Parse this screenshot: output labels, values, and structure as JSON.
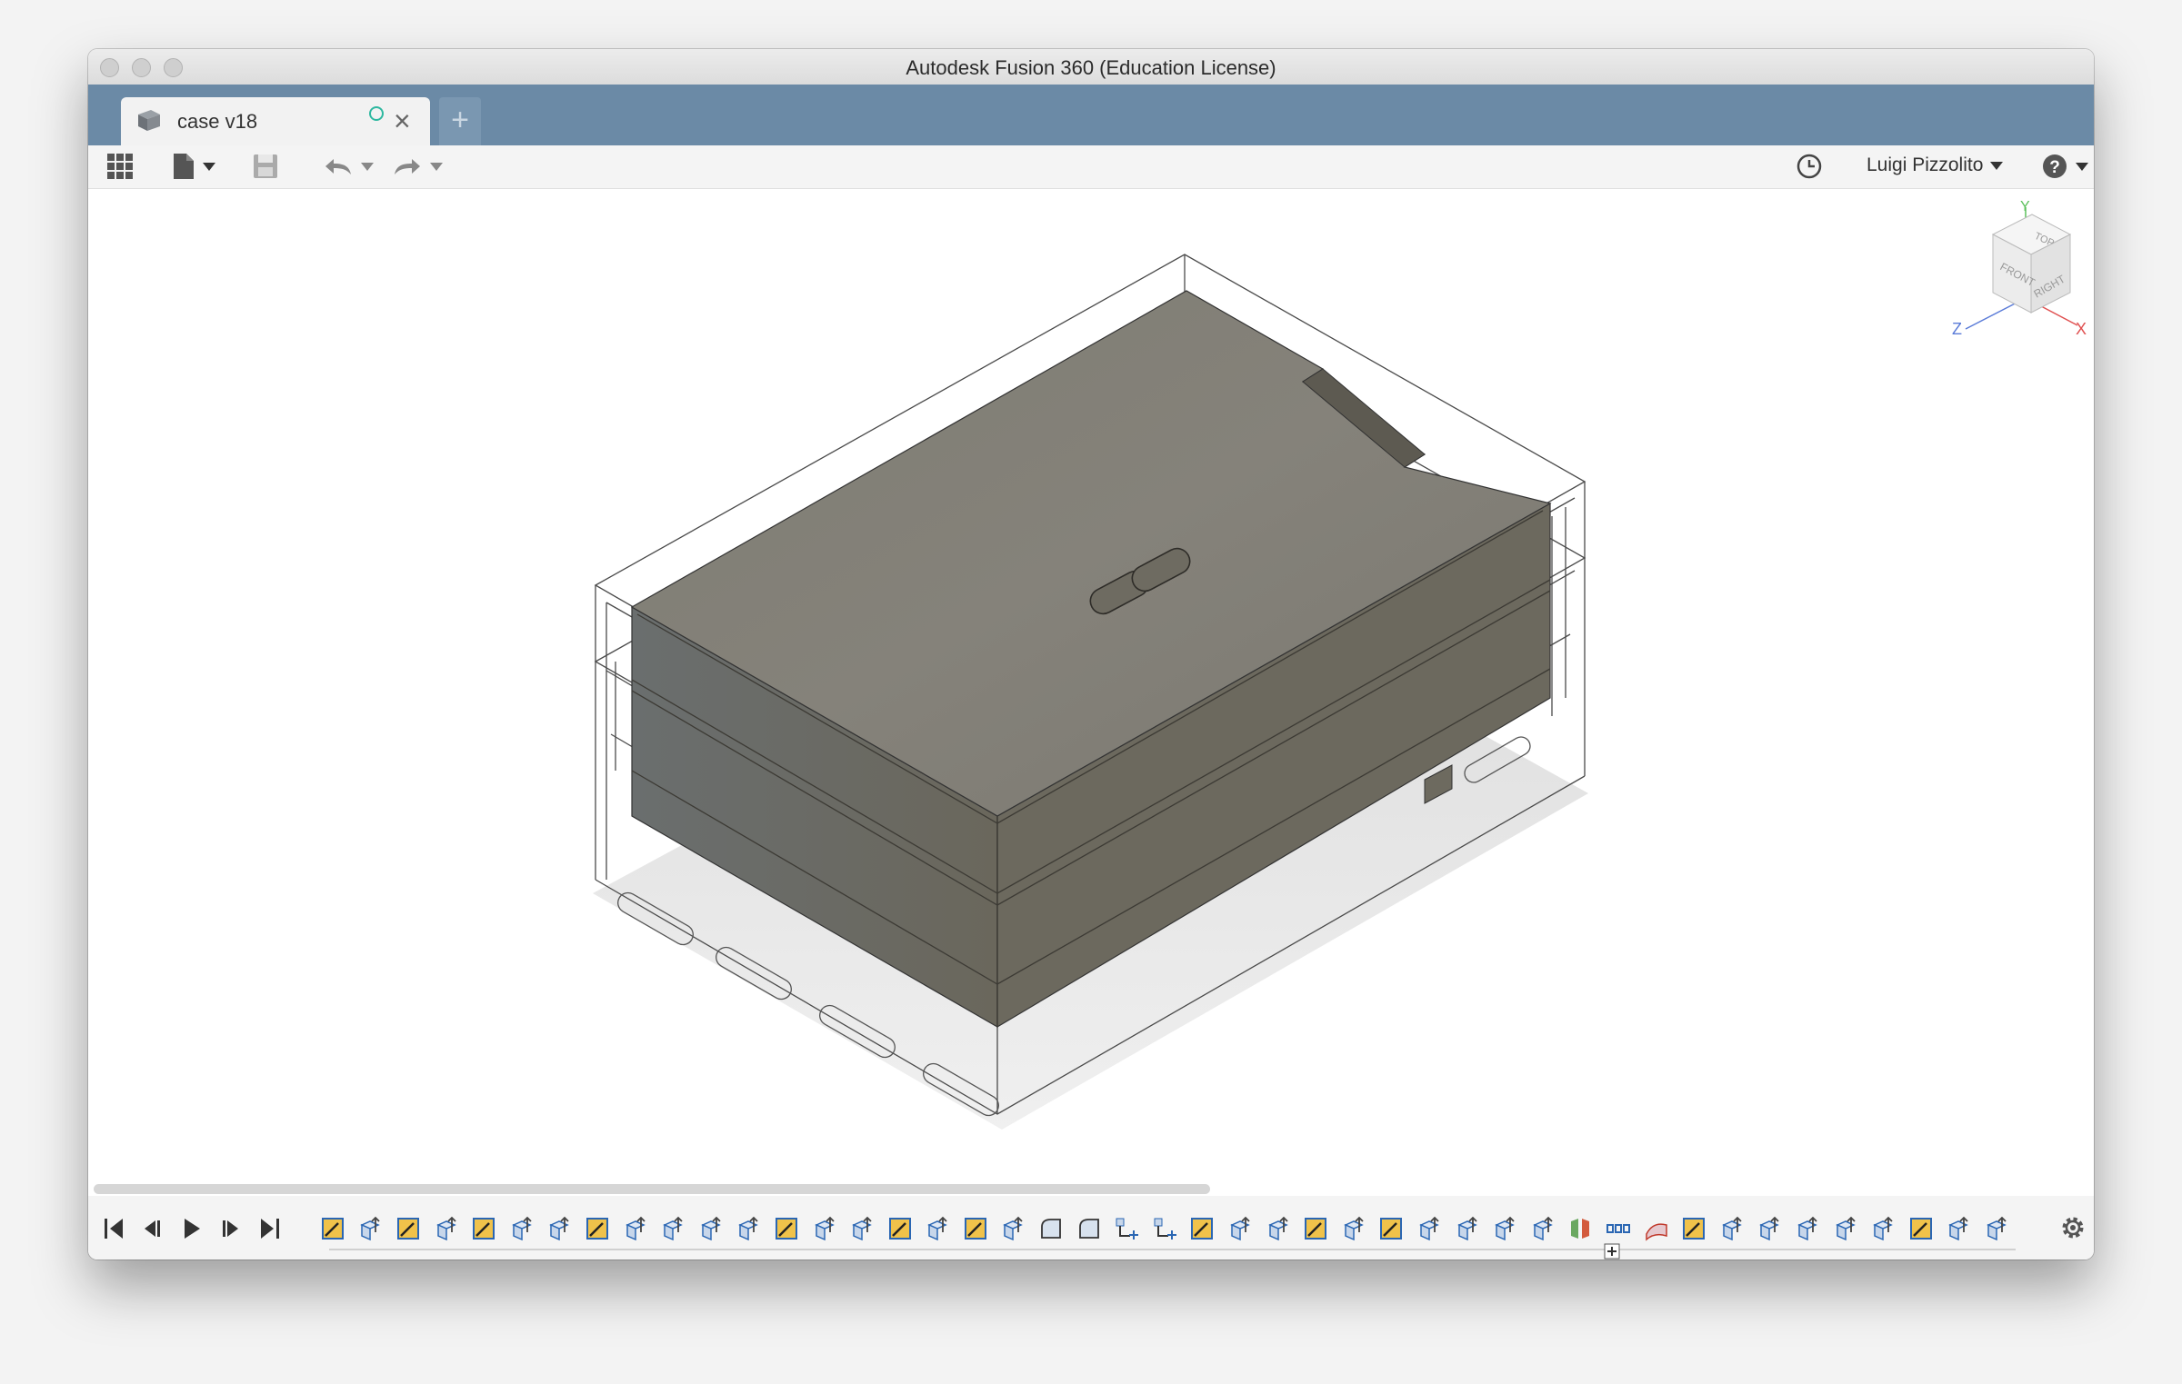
{
  "window": {
    "title": "Autodesk Fusion 360 (Education License)"
  },
  "tabs": [
    {
      "label": "case v18",
      "icon": "box-icon"
    }
  ],
  "toolbar": {
    "items": [
      "grid-menu-icon",
      "file-icon",
      "save-icon",
      "undo-icon",
      "redo-icon",
      "history-icon",
      "help-icon"
    ],
    "user_name": "Luigi Pizzolito"
  },
  "viewcube": {
    "faces": {
      "top": "TOP",
      "front": "FRONT",
      "right": "RIGHT"
    },
    "axes": {
      "x": "X",
      "y": "Y",
      "z": "Z"
    },
    "colors": {
      "x": "#e05050",
      "y": "#5cc05c",
      "z": "#5a7bd8"
    }
  },
  "model": {
    "color": "#6d6a5f",
    "description_visible": false
  },
  "timeline": {
    "controls": [
      "first-step-icon",
      "previous-step-icon",
      "play-icon",
      "next-step-icon",
      "last-step-icon"
    ],
    "features": [
      "sketch",
      "extrude",
      "sketch",
      "extrude",
      "sketch",
      "extrude",
      "extrude",
      "sketch",
      "extrude",
      "extrude",
      "extrude",
      "extrude",
      "sketch",
      "extrude",
      "extrude",
      "sketch",
      "extrude",
      "sketch",
      "extrude",
      "fillet",
      "fillet",
      "joint",
      "joint",
      "sketch",
      "extrude",
      "extrude",
      "sketch",
      "extrude",
      "sketch",
      "extrude",
      "extrude",
      "extrude",
      "extrude",
      "split",
      "pattern",
      "surface",
      "sketch",
      "extrude",
      "extrude",
      "extrude",
      "extrude",
      "extrude",
      "sketch",
      "extrude",
      "extrude"
    ],
    "colors": {
      "sketch_fill": "#f0c24a",
      "sketch_stroke": "#2a66b3",
      "extrude_stroke": "#2a66b3"
    }
  }
}
